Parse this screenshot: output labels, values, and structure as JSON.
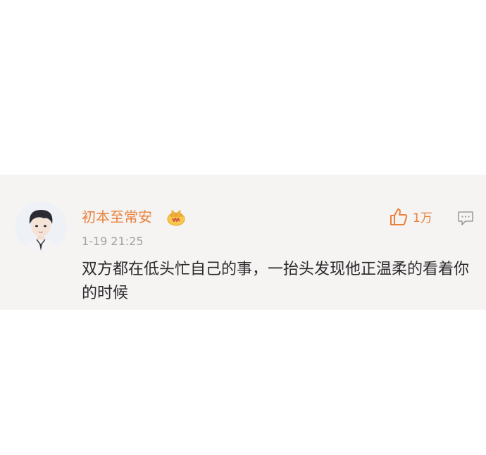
{
  "comment": {
    "username": "初本至常安",
    "vip_badge_icon": "crown-vip-badge-icon",
    "timestamp": "1-19 21:25",
    "likes": "1万",
    "text": "双方都在低头忙自己的事，一抬头发现他正温柔的看着你的时候"
  },
  "colors": {
    "card_background": "#f6f3f3",
    "username": "#e8823b",
    "like": "#e8823b",
    "timestamp": "#a3a0a0",
    "text": "#2a2a2a",
    "reply_icon": "#9e9c9c"
  },
  "icons": {
    "like": "thumbs-up-icon",
    "reply": "comment-bubble-icon"
  }
}
